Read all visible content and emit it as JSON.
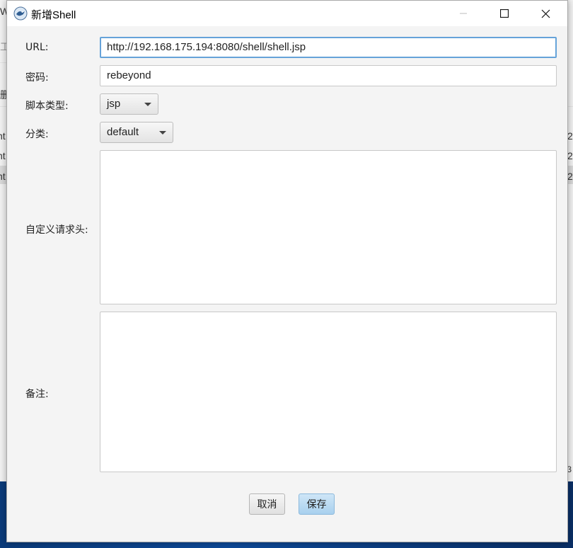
{
  "background": {
    "left_cells": [
      "W",
      "工",
      "删",
      "nt",
      "nt",
      "nt"
    ],
    "right_cells": [
      "2",
      "2",
      "2"
    ],
    "right_bottom": "\\3"
  },
  "dialog": {
    "title": "新增Shell",
    "window_controls": {
      "minimize": "minimize-icon",
      "maximize": "maximize-icon",
      "close": "close-icon"
    },
    "fields": {
      "url_label": "URL:",
      "url_value": "http://192.168.175.194:8080/shell/shell.jsp",
      "password_label": "密码:",
      "password_value": "rebeyond",
      "script_type_label": "脚本类型:",
      "script_type_value": "jsp",
      "category_label": "分类:",
      "category_value": "default",
      "headers_label": "自定义请求头:",
      "headers_value": "",
      "notes_label": "备注:",
      "notes_value": ""
    },
    "buttons": {
      "cancel": "取消",
      "save": "保存"
    }
  },
  "colors": {
    "focus_border": "#66a3d9",
    "primary_button": "#a8d0ee"
  }
}
